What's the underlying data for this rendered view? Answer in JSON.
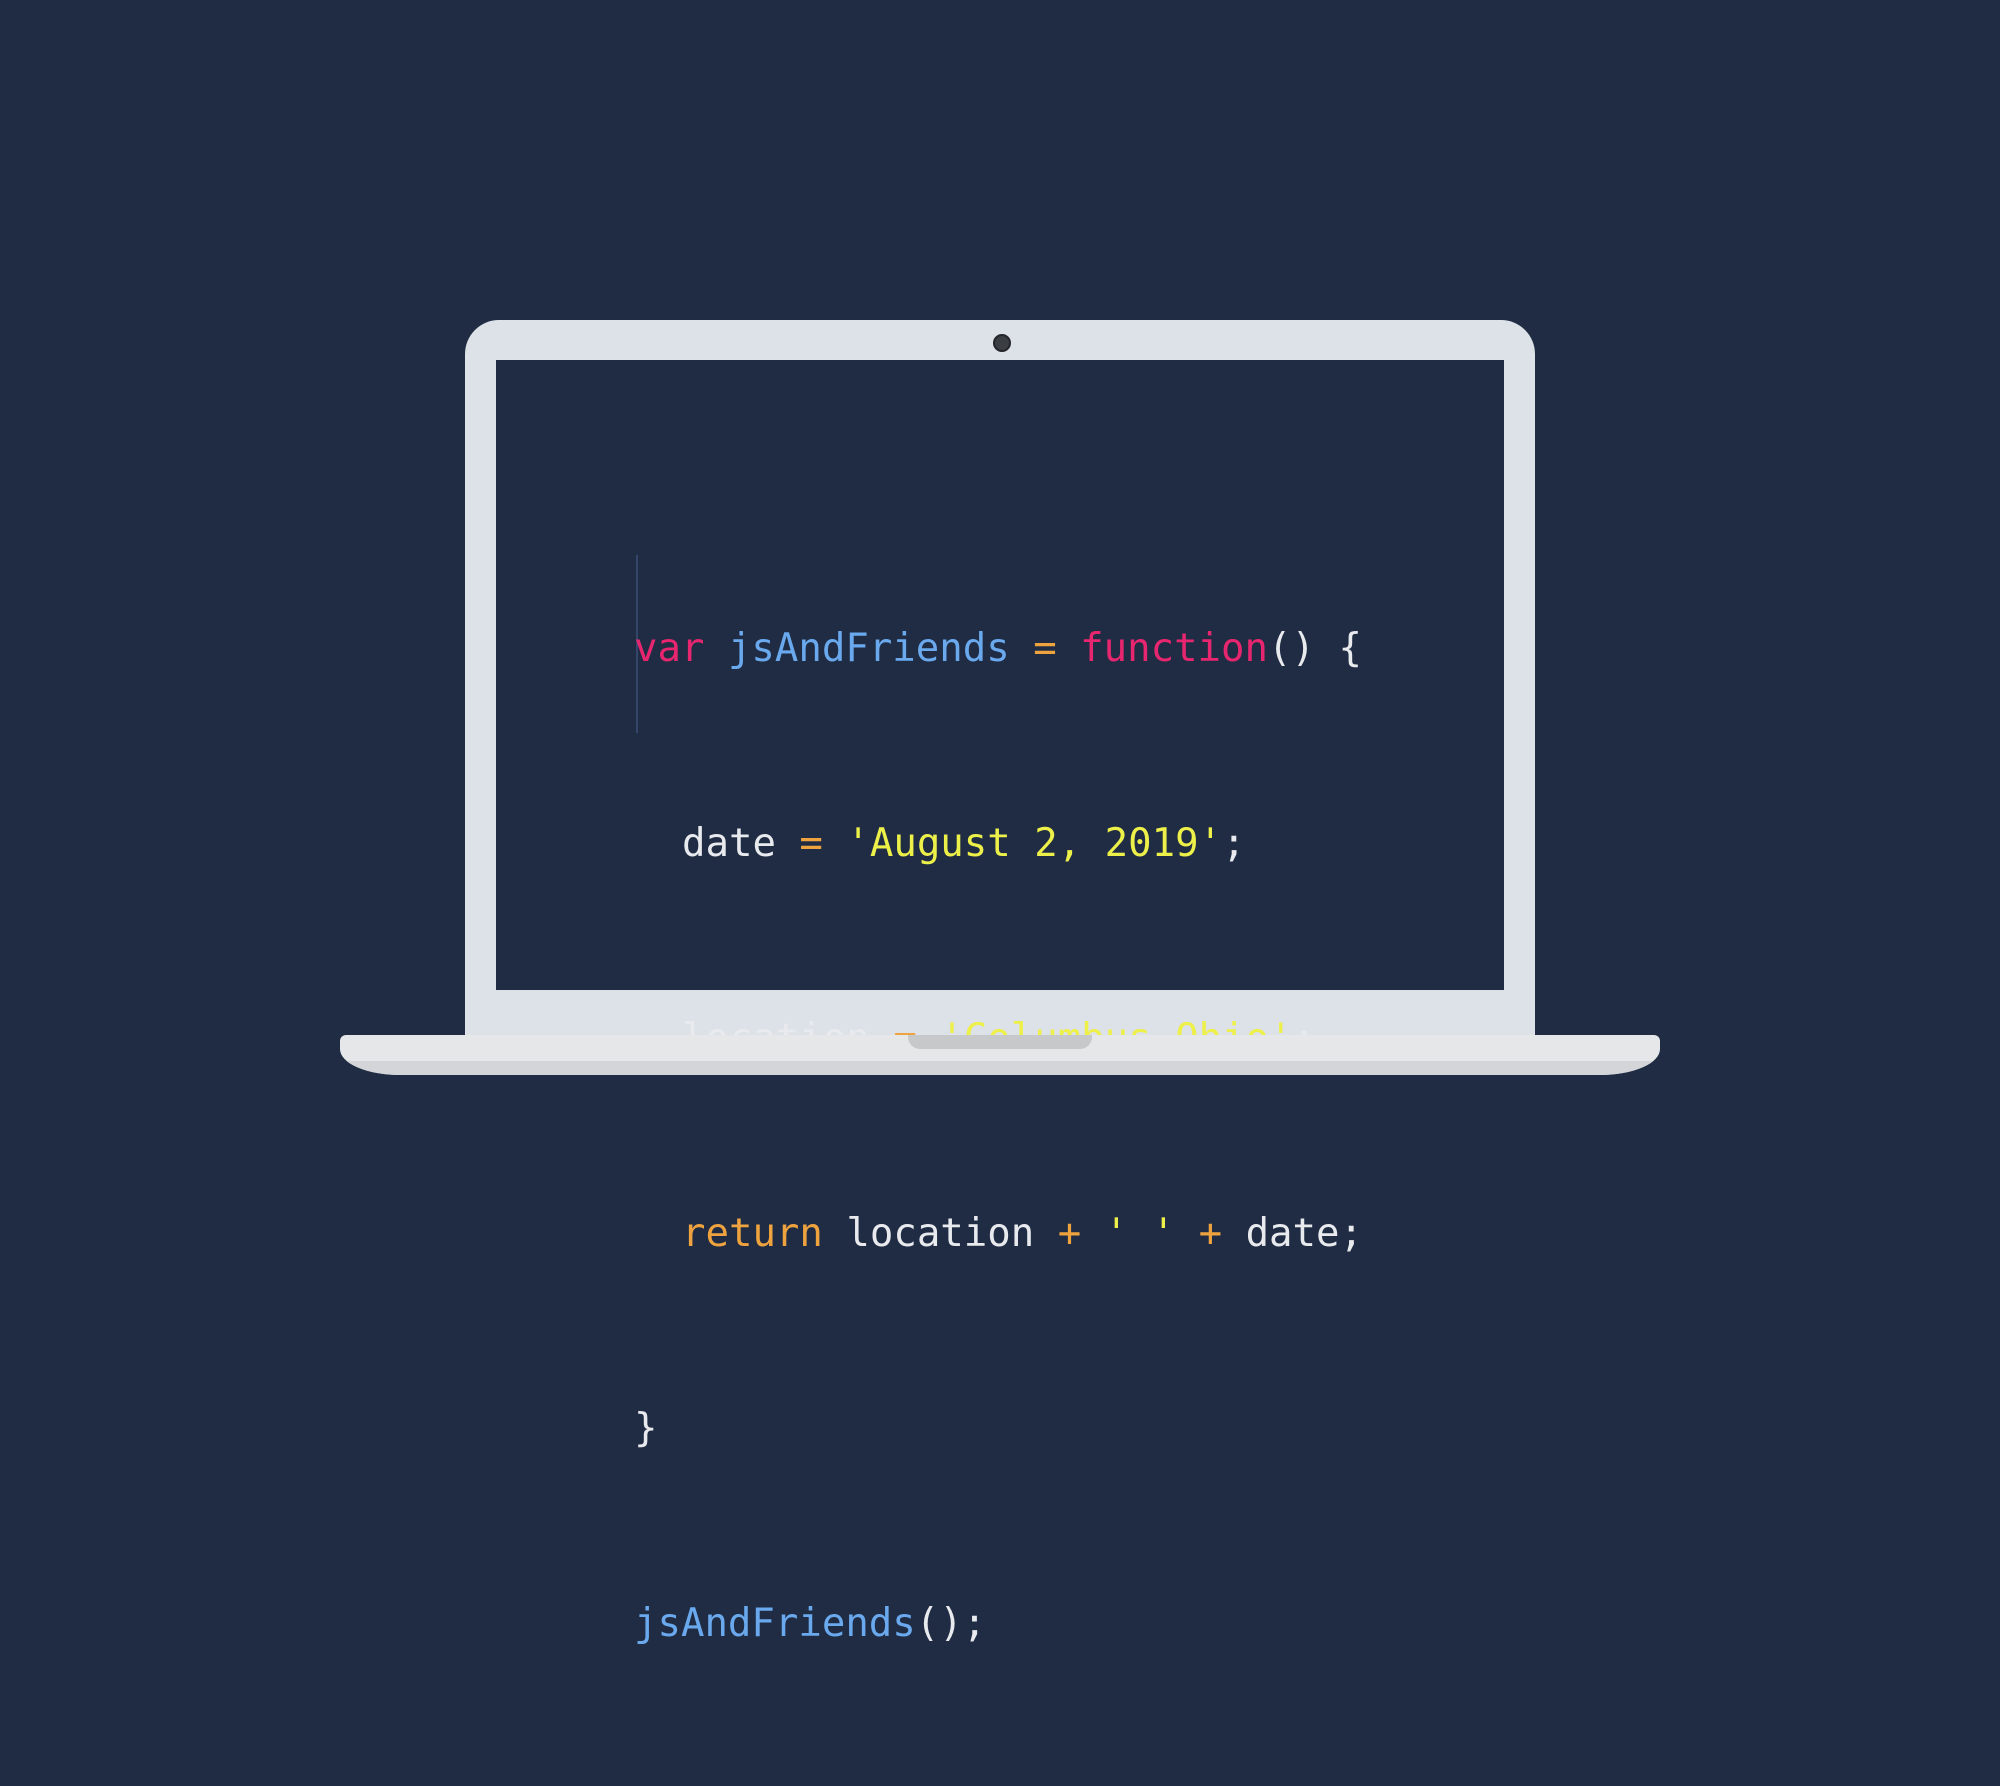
{
  "code": {
    "line1": {
      "kw": "var",
      "name": "jsAndFriends",
      "eq": "=",
      "fn_kw": "function",
      "rest": "() {"
    },
    "line2": {
      "ident": "date",
      "eq": "=",
      "str": "'August 2, 2019'",
      "end": ";"
    },
    "line3": {
      "ident": "location",
      "eq": "=",
      "str": "'Columbus Ohio'",
      "end": ";"
    },
    "line4": {
      "kw": "return",
      "ident": "location",
      "plus1": "+",
      "str": "' '",
      "plus2": "+",
      "ident2": "date",
      "end": ";"
    },
    "line5": {
      "brace": "}"
    },
    "line6": {
      "name": "jsAndFriends",
      "rest": "();"
    }
  },
  "colors": {
    "background": "#1f2c44",
    "keyword_pink": "#e8266f",
    "keyword_orange": "#efa33f",
    "function_name": "#6aa9ee",
    "string": "#eef04a",
    "text": "#e8eaee"
  },
  "icons": {
    "camera": "camera-icon"
  }
}
